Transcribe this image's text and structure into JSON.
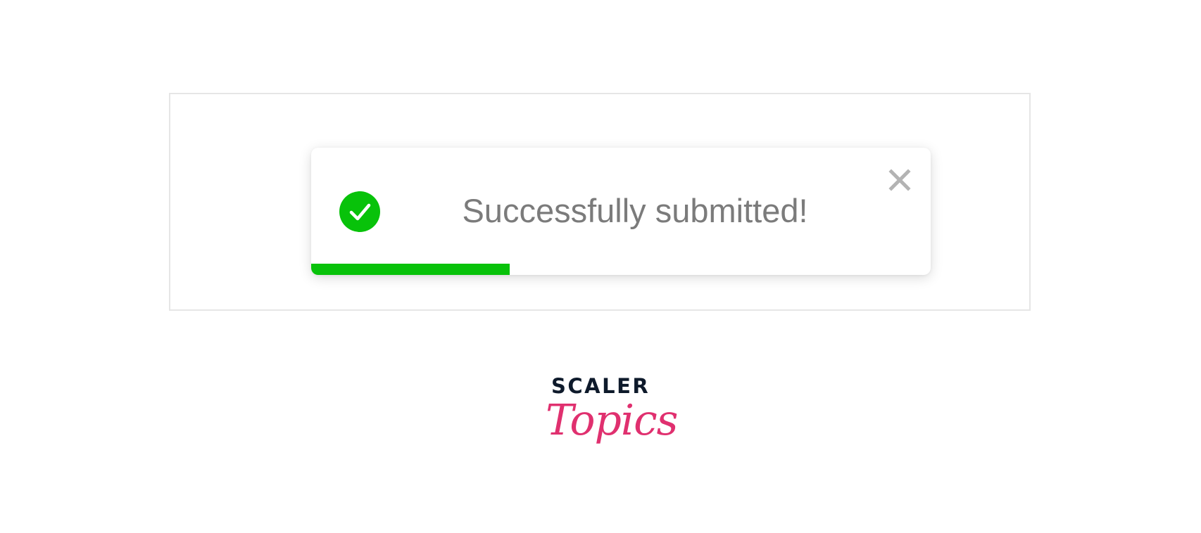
{
  "toast": {
    "message": "Successfully submitted!",
    "status": "success",
    "progress_fraction": 0.32,
    "icons": {
      "status": "check-circle-icon",
      "close": "close-icon"
    }
  },
  "logo": {
    "line1": "SCALER",
    "line2": "Topics"
  },
  "colors": {
    "success_green": "#08c20a",
    "message_text": "#7b7b7b",
    "close_icon": "#b3b3b3",
    "frame_border": "#e6e6e6",
    "logo_dark": "#0e1a2b",
    "logo_pink": "#e0306f"
  }
}
